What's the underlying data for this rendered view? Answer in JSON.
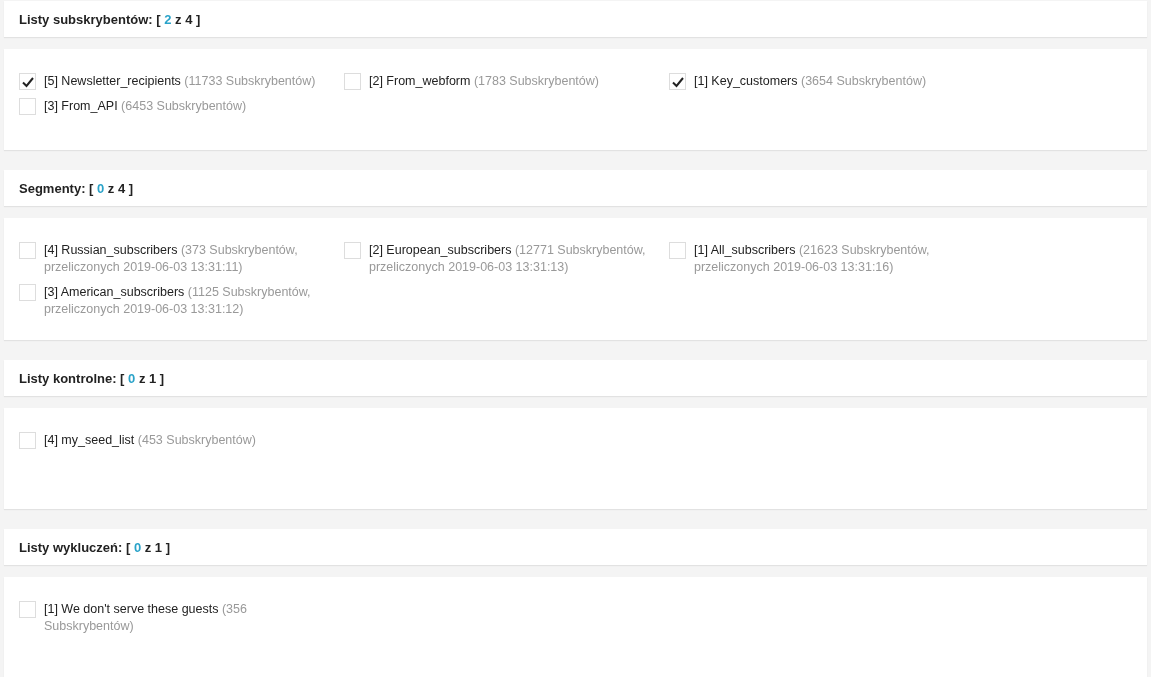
{
  "sections": [
    {
      "title": "Listy subskrybentów:",
      "open": "[",
      "selected_count": "2",
      "rest": "z 4 ]",
      "items": [
        {
          "label": "[5] Newsletter_recipients",
          "detail": "(11733 Subskrybentów)",
          "checked": true
        },
        {
          "label": "[2] From_webform",
          "detail": "(1783 Subskrybentów)",
          "checked": false
        },
        {
          "label": "[1] Key_customers",
          "detail": "(3654 Subskrybentów)",
          "checked": true
        },
        {
          "label": "[3] From_API",
          "detail": "(6453 Subskrybentów)",
          "checked": false
        }
      ]
    },
    {
      "title": "Segmenty:",
      "open": "[",
      "selected_count": "0",
      "rest": "z 4 ]",
      "items": [
        {
          "label": "[4] Russian_subscribers",
          "detail": "(373 Subskrybentów, przeliczonych 2019-06-03 13:31:11)",
          "checked": false
        },
        {
          "label": "[2] European_subscribers",
          "detail": "(12771 Subskrybentów, przeliczonych 2019-06-03 13:31:13)",
          "checked": false
        },
        {
          "label": "[1] All_subscribers",
          "detail": "(21623 Subskrybentów, przeliczonych 2019-06-03 13:31:16)",
          "checked": false
        },
        {
          "label": "[3] American_subscribers",
          "detail": "(1125 Subskrybentów, przeliczonych 2019-06-03 13:31:12)",
          "checked": false
        }
      ]
    },
    {
      "title": "Listy kontrolne:",
      "open": "[",
      "selected_count": "0",
      "rest": "z 1 ]",
      "items": [
        {
          "label": "[4] my_seed_list",
          "detail": "(453 Subskrybentów)",
          "checked": false
        }
      ]
    },
    {
      "title": "Listy wykluczeń:",
      "open": "[",
      "selected_count": "0",
      "rest": "z 1 ]",
      "items": [
        {
          "label": "[1] We don't serve these guests",
          "detail": "(356 Subskrybentów)",
          "checked": false
        }
      ]
    }
  ]
}
